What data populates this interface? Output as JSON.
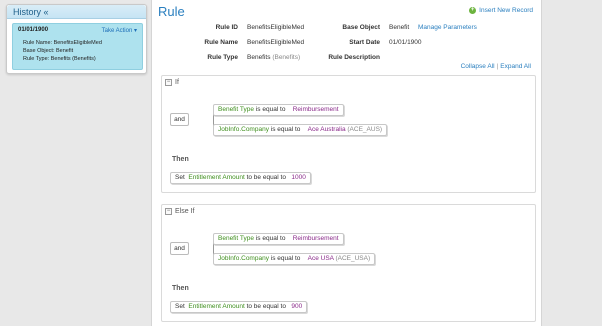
{
  "sidebar": {
    "title": "History «",
    "item": {
      "date": "01/01/1900",
      "take_action": "Take Action ▾",
      "details": [
        "Rule Name: BenefitsEligibleMed",
        "Base Object: Benefit",
        "Rule Type: Benefits (Benefits)"
      ]
    }
  },
  "main": {
    "title": "Rule",
    "insert_label": "Insert New Record",
    "props": {
      "rule_id_label": "Rule ID",
      "rule_id": "BenefitsEligibleMed",
      "base_object_label": "Base Object",
      "base_object": "Benefit",
      "manage_params": "Manage Parameters",
      "rule_name_label": "Rule Name",
      "rule_name": "BenefitsEligibleMed",
      "start_date_label": "Start Date",
      "start_date": "01/01/1900",
      "rule_type_label": "Rule Type",
      "rule_type": "Benefits",
      "rule_type_paren": "(Benefits)",
      "rule_desc_label": "Rule Description"
    },
    "collapse_all": "Collapse All",
    "separator": "|",
    "expand_all": "Expand All"
  },
  "if_section": {
    "label": "If",
    "toggle": "−",
    "operator": "and",
    "conditions": [
      {
        "field": "Benefit Type",
        "op": "is equal to",
        "value": "Reimbursement",
        "extra": ""
      },
      {
        "field": "JobInfo.Company",
        "op": "is equal to",
        "value": "Ace Australia",
        "extra": "(ACE_AUS)"
      }
    ],
    "then_label": "Then",
    "action": {
      "verb": "Set",
      "field": "Entitlement Amount",
      "op": "to be equal to",
      "value": "1000"
    }
  },
  "elseif_section": {
    "label": "Else If",
    "toggle": "−",
    "operator": "and",
    "conditions": [
      {
        "field": "Benefit Type",
        "op": "is equal to",
        "value": "Reimbursement",
        "extra": ""
      },
      {
        "field": "JobInfo.Company",
        "op": "is equal to",
        "value": "Ace USA",
        "extra": "(ACE_USA)"
      }
    ],
    "then_label": "Then",
    "action": {
      "verb": "Set",
      "field": "Entitlement Amount",
      "op": "to be equal to",
      "value": "900"
    }
  }
}
